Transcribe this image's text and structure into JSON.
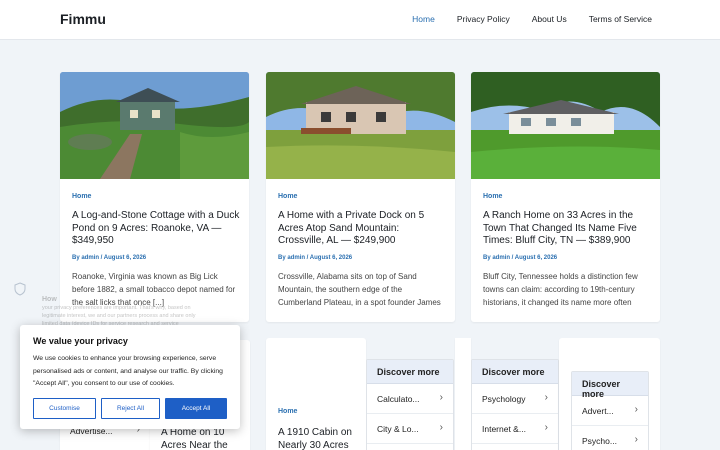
{
  "header": {
    "logo": "Fimmu",
    "nav": [
      "Home",
      "Privacy Policy",
      "About Us",
      "Terms of Service"
    ],
    "active_index": 0
  },
  "posts": [
    {
      "category": "Home",
      "title": "A Log-and-Stone Cottage with a Duck Pond on 9 Acres: Roanoke, VA — $349,950",
      "meta": "By admin / August 6, 2026",
      "excerpt": "Roanoke, Virginia was known as Big Lick before 1882, a small tobacco depot named for the salt licks that once [...]"
    },
    {
      "category": "Home",
      "title": "A Home with a Private Dock on 5 Acres Atop Sand Mountain: Crossville, AL — $249,900",
      "meta": "By admin / August 6, 2026",
      "excerpt": "Crossville, Alabama sits on top of Sand Mountain, the southern edge of the Cumberland Plateau, in a spot founder James"
    },
    {
      "category": "Home",
      "title": "A Ranch Home on 33 Acres in the Town That Changed Its Name Five Times: Bluff City, TN — $389,900",
      "meta": "By admin / August 6, 2026",
      "excerpt": "Bluff City, Tennessee holds a distinction few towns can claim: according to 19th-century historians, it changed its name more often"
    }
  ],
  "lower_posts": [
    {
      "title": "A Home on 10 Acres Near the"
    },
    {
      "category": "Home",
      "title": "A 1910 Cabin on Nearly 30 Acres"
    }
  ],
  "discover": [
    {
      "heading": "Discover more",
      "items": [
        "Calculato...",
        "City & Lo..."
      ]
    },
    {
      "heading": "Discover more",
      "items": [
        "Psychology",
        "Internet &..."
      ]
    },
    {
      "heading": "Discover more",
      "items": [
        "Advert...",
        "Psycho..."
      ]
    }
  ],
  "left_partial": {
    "item": "Advertise..."
  },
  "cookie": {
    "ghost_heading": "How",
    "ghost_text": "your privacy preferences are important. That's why, based on legitimate interest, we and our partners process and share only limited data (device IDs for service research and service",
    "title": "We value your privacy",
    "text": "We use cookies to enhance your browsing experience, serve personalised ads or content, and analyse our traffic. By clicking \"Accept All\", you consent to our use of cookies.",
    "customise": "Customise",
    "reject": "Reject All",
    "accept": "Accept All"
  },
  "colors": {
    "accent": "#2a6fb0",
    "button": "#1e5fc6",
    "background": "#f0f4f8"
  }
}
